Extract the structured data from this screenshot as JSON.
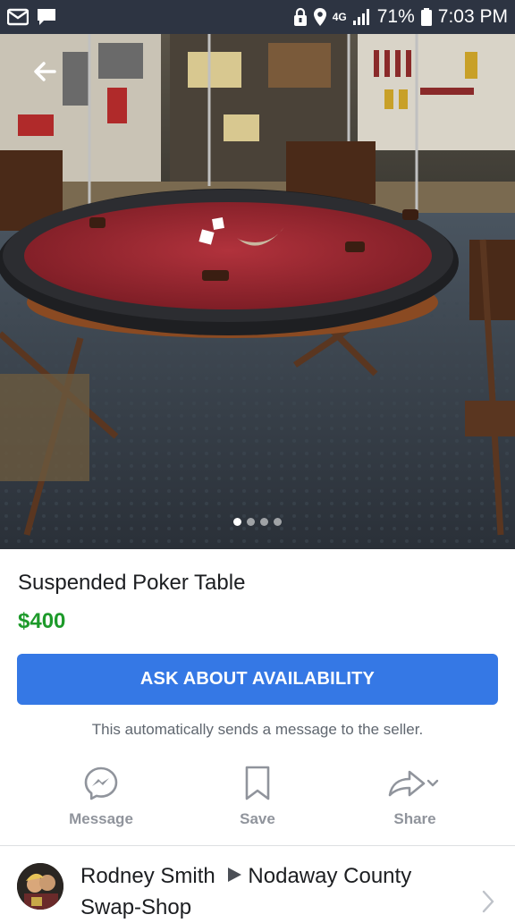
{
  "status_bar": {
    "network": "4G",
    "battery": "71%",
    "time": "7:03 PM",
    "icons": [
      "email-icon",
      "chat-icon",
      "lock-icon",
      "location-icon",
      "signal-icon",
      "battery-icon"
    ]
  },
  "photo": {
    "alt_icon": "back-arrow-icon",
    "page_count": 4,
    "current_page": 1
  },
  "listing": {
    "title": "Suspended Poker Table",
    "price": "$400",
    "price_color": "#1d9a2a"
  },
  "ask": {
    "button_label": "ASK ABOUT AVAILABILITY",
    "note": "This automatically sends a message to the seller.",
    "button_color": "#3578e5"
  },
  "actions": [
    {
      "label": "Message",
      "icon": "messenger-icon"
    },
    {
      "label": "Save",
      "icon": "bookmark-icon"
    },
    {
      "label": "Share",
      "icon": "share-icon"
    }
  ],
  "seller": {
    "name": "Rodney Smith",
    "group": "Nodaway County Swap-Shop"
  }
}
